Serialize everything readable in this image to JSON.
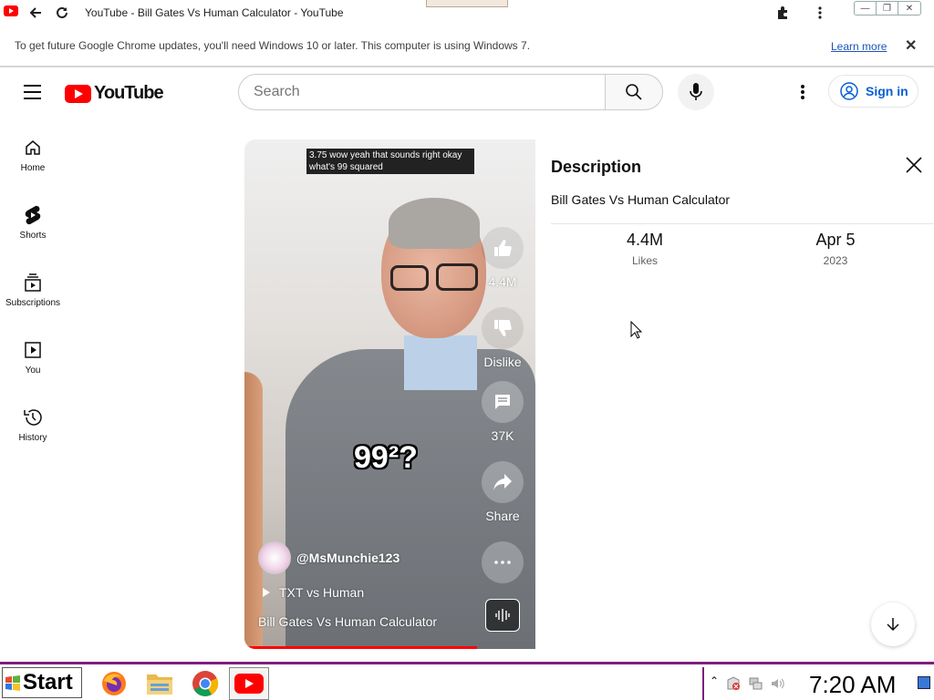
{
  "browser": {
    "tab_title": "YouTube - Bill Gates Vs Human Calculator - YouTube",
    "info_bar": {
      "message": "To get future Google Chrome updates, you'll need Windows 10 or later. This computer is using Windows 7.",
      "learn_more": "Learn more"
    }
  },
  "header": {
    "logo_text": "YouTube",
    "search_placeholder": "Search",
    "signin_label": "Sign in"
  },
  "sidebar": {
    "items": [
      {
        "label": "Home",
        "icon": "home-icon"
      },
      {
        "label": "Shorts",
        "icon": "shorts-icon"
      },
      {
        "label": "Subscriptions",
        "icon": "subscriptions-icon"
      },
      {
        "label": "You",
        "icon": "you-icon"
      },
      {
        "label": "History",
        "icon": "history-icon"
      }
    ]
  },
  "video": {
    "caption": "3.75 wow yeah that sounds right okay what's 99 squared",
    "overlay_text": "99²?",
    "channel": "@MsMunchie123",
    "playlist": "TXT vs Human",
    "title": "Bill Gates Vs Human Calculator",
    "progress_fraction": 0.8,
    "actions": {
      "like_count": "4.4M",
      "dislike_label": "Dislike",
      "comment_count": "37K",
      "share_label": "Share"
    }
  },
  "description": {
    "heading": "Description",
    "title": "Bill Gates Vs Human Calculator",
    "likes_value": "4.4M",
    "likes_label": "Likes",
    "date_value": "Apr 5",
    "date_year": "2023"
  },
  "taskbar": {
    "start_label": "Start",
    "clock": "7:20 AM",
    "apps": [
      "firefox-icon",
      "file-explorer-icon",
      "chrome-icon",
      "youtube-icon"
    ]
  },
  "colors": {
    "youtube_red": "#ff0000",
    "link_blue": "#065fd4",
    "taskbar_accent": "#7e1e7e"
  }
}
